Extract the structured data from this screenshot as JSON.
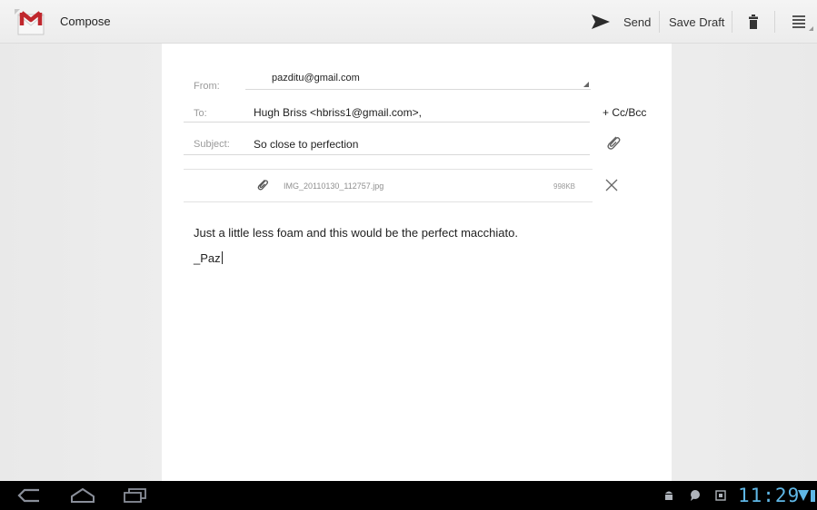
{
  "app": {
    "title": "Compose",
    "icon": "gmail-icon"
  },
  "actionbar": {
    "send_label": "Send",
    "save_draft_label": "Save Draft"
  },
  "compose": {
    "from_label": "From:",
    "from_value": "pazditu@gmail.com",
    "to_label": "To:",
    "to_value": "Hugh Briss <hbriss1@gmail.com>,",
    "cc_bcc_label": "+ Cc/Bcc",
    "subject_label": "Subject:",
    "subject_value": "So close to perfection",
    "attachment": {
      "name": "IMG_20110130_112757.jpg",
      "size": "998KB"
    },
    "body_line1": "Just a little less foam and this would be the perfect macchiato.",
    "body_line2": "_Paz"
  },
  "system_bar": {
    "time": "11:29",
    "clock_color": "#5fb7e6"
  }
}
